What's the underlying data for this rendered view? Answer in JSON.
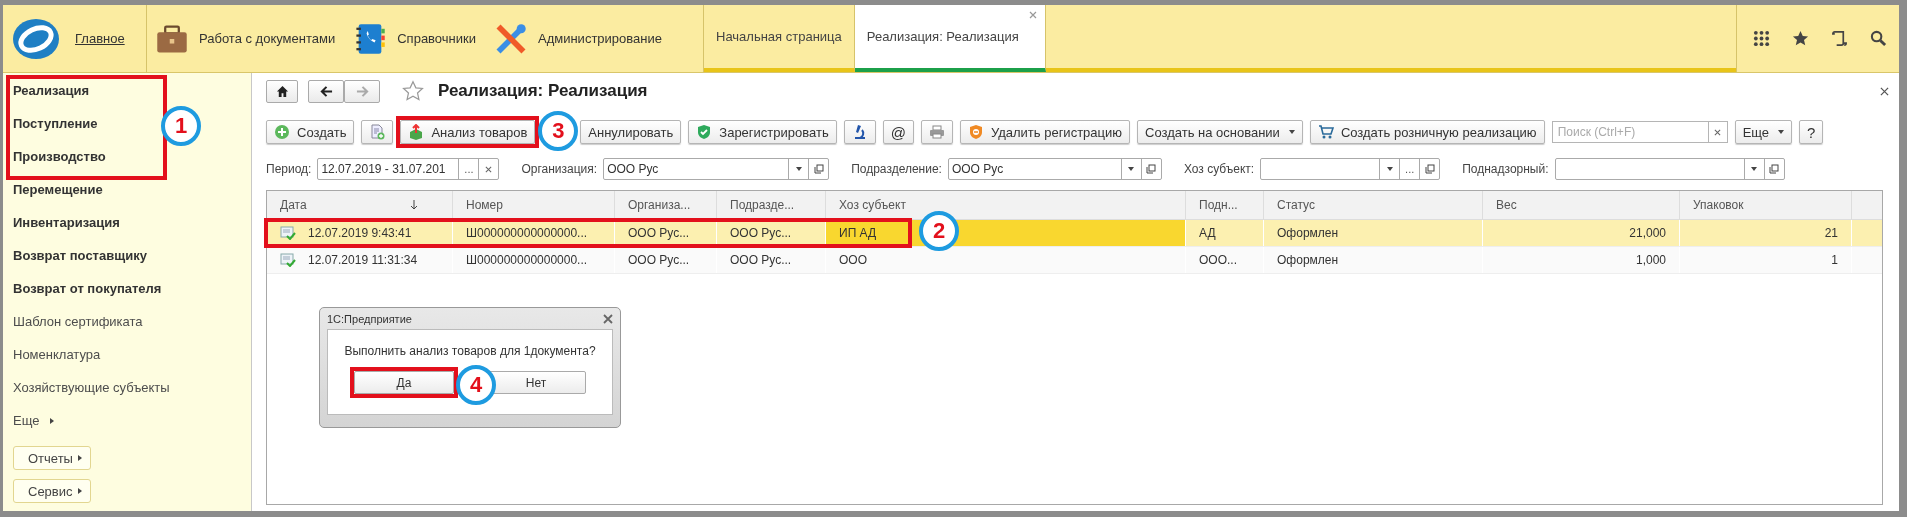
{
  "header": {
    "home_link": "Главное",
    "sections": [
      {
        "label": "Работа с документами"
      },
      {
        "label": "Справочники"
      },
      {
        "label": "Администрирование"
      }
    ],
    "open_tabs": [
      {
        "label": "Начальная страница",
        "selected": false
      },
      {
        "label": "Реализация: Реализация",
        "selected": true
      }
    ]
  },
  "sidebar": {
    "marked_callout": "1",
    "marked_items": [
      {
        "label": "Реализация",
        "bold": true
      },
      {
        "label": "Поступление",
        "bold": true
      },
      {
        "label": "Производство",
        "bold": true
      }
    ],
    "items": [
      {
        "label": "Перемещение",
        "bold": true
      },
      {
        "label": "Инвентаризация",
        "bold": true
      },
      {
        "label": "Возврат поставщику",
        "bold": true
      },
      {
        "label": "Возврат от покупателя",
        "bold": true
      },
      {
        "label": "Шаблон сертификата",
        "bold": false
      },
      {
        "label": "Номенклатура",
        "bold": false
      },
      {
        "label": "Хозяйствующие субъекты",
        "bold": false
      }
    ],
    "more": "Еще",
    "buttons": [
      "Отчеты",
      "Сервис"
    ]
  },
  "form": {
    "title": "Реализация: Реализация",
    "toolbar": [
      {
        "kind": "button",
        "label": "Создать"
      },
      {
        "kind": "icon_button"
      },
      {
        "kind": "button",
        "label": "Анализ товаров",
        "callout": "3"
      },
      {
        "kind": "button",
        "label": "Аннулировать"
      },
      {
        "kind": "button",
        "label": "Зарегистрировать"
      },
      {
        "kind": "icon_button"
      },
      {
        "kind": "text_button",
        "label": "@"
      },
      {
        "kind": "icon_button"
      },
      {
        "kind": "button",
        "label": "Удалить регистрацию"
      },
      {
        "kind": "menu_button",
        "label": "Создать на основании"
      },
      {
        "kind": "button",
        "label": "Создать розничную реализацию"
      },
      {
        "kind": "search",
        "placeholder": "Поиск (Ctrl+F)"
      },
      {
        "kind": "menu_button",
        "label": "Еще"
      },
      {
        "kind": "text_button",
        "label": "?"
      }
    ],
    "filters": [
      {
        "kind": "period",
        "label": "Период:",
        "value": "12.07.2019 - 31.07.201",
        "choose_label": "..."
      },
      {
        "kind": "select",
        "label": "Организация:",
        "value": "ООО Рус"
      },
      {
        "kind": "select",
        "label": "Подразделение:",
        "value": "ООО Рус"
      },
      {
        "kind": "select_choose",
        "label": "Хоз субъект:",
        "choose_label": "..."
      },
      {
        "kind": "select",
        "label": "Поднадзорный:"
      }
    ]
  },
  "table": {
    "columns": [
      {
        "label": "Дата",
        "sorted": true
      },
      {
        "label": "Номер",
        "sorted": false
      },
      {
        "label": "Организа...",
        "sorted": false
      },
      {
        "label": "Подразде...",
        "sorted": false
      },
      {
        "label": "Хоз субъект",
        "sorted": false
      },
      {
        "label": "Подн...",
        "sorted": false
      },
      {
        "label": "Статус",
        "sorted": false
      },
      {
        "label": "Вес",
        "sorted": false
      },
      {
        "label": "Упаковок",
        "sorted": false
      }
    ],
    "rows": [
      {
        "selected": true,
        "callout": "2",
        "cells": [
          {
            "text": "12.07.2019 9:43:41",
            "focused": false
          },
          {
            "text": "Ш000000000000000...",
            "focused": false
          },
          {
            "text": "ООО Рус...",
            "focused": false
          },
          {
            "text": "ООО Рус...",
            "focused": false
          },
          {
            "text": "ИП АД",
            "focused": true
          },
          {
            "text": "АД",
            "focused": false
          },
          {
            "text": "Оформлен",
            "focused": false
          },
          {
            "text": "21,000",
            "focused": false
          },
          {
            "text": "21",
            "focused": false
          }
        ]
      },
      {
        "selected": false,
        "cells": [
          {
            "text": "12.07.2019 11:31:34",
            "focused": false
          },
          {
            "text": "Ш000000000000000...",
            "focused": false
          },
          {
            "text": "ООО Рус...",
            "focused": false
          },
          {
            "text": "ООО Рус...",
            "focused": false
          },
          {
            "text": "ООО",
            "focused": false
          },
          {
            "text": "ООО...",
            "focused": false
          },
          {
            "text": "Оформлен",
            "focused": false
          },
          {
            "text": "1,000",
            "focused": false
          },
          {
            "text": "1",
            "focused": false
          }
        ]
      }
    ]
  },
  "dialog": {
    "title": "1С:Предприятие",
    "message": "Выполнить анализ товаров для 1документа?",
    "buttons": [
      {
        "label": "Да",
        "callout": "4"
      },
      {
        "label": "Нет"
      }
    ]
  }
}
